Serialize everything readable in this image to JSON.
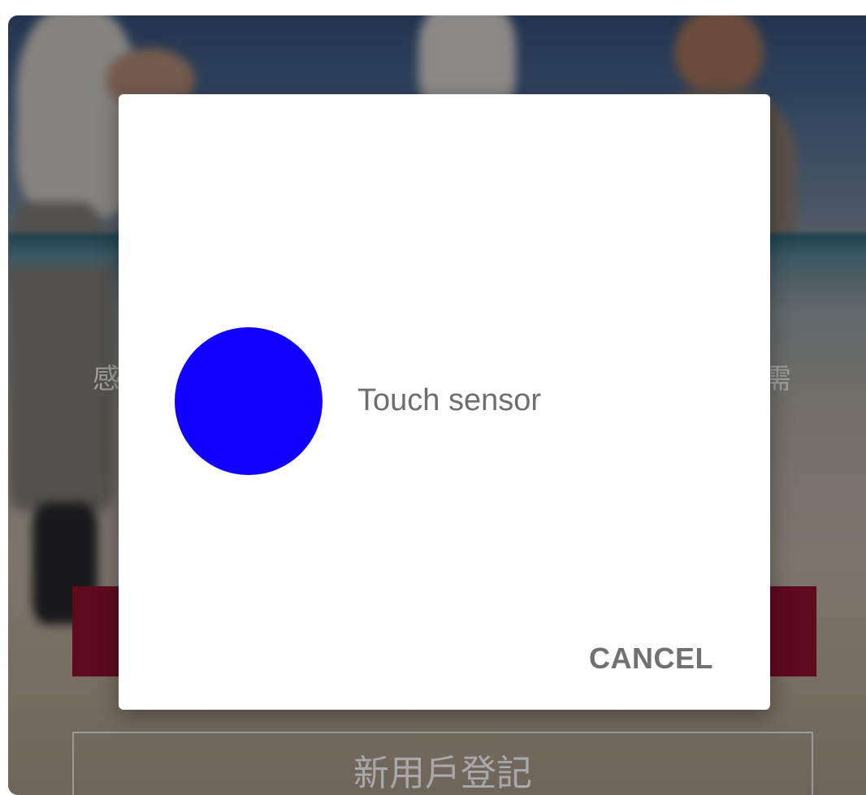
{
  "background": {
    "left_text": "感",
    "right_text": "需",
    "primary_button_color": "#5f0a1d",
    "outline_button_label": "新用戶登記"
  },
  "dialog": {
    "icon": "touch-sensor-circle-icon",
    "icon_color": "#1200ff",
    "message": "Touch sensor",
    "cancel_label": "CANCEL"
  }
}
